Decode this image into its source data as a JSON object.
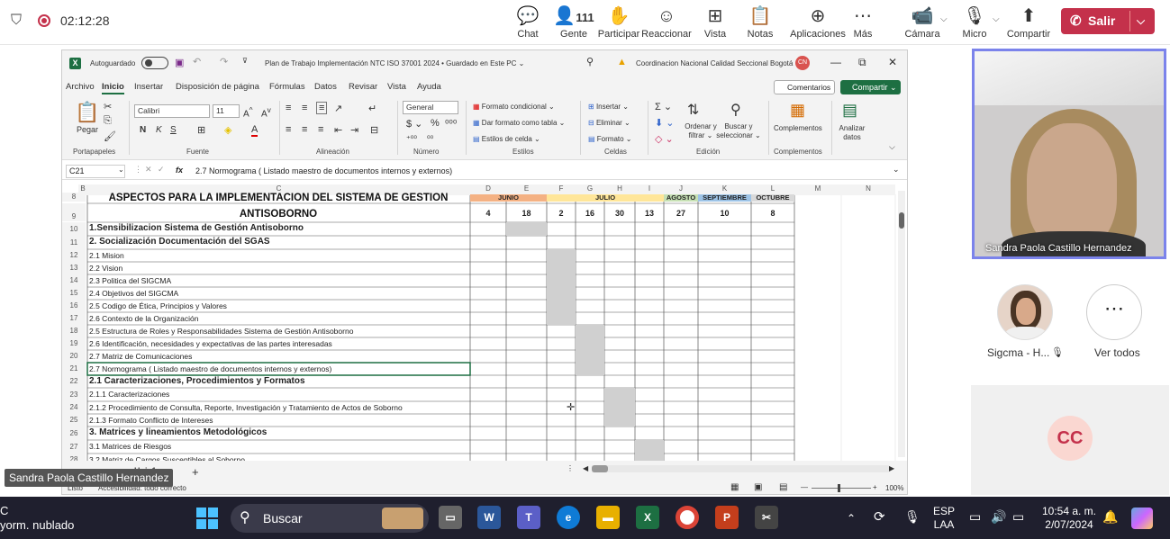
{
  "teams": {
    "timer": "02:12:28",
    "toolbar": [
      {
        "label": "Chat",
        "icon": "chat-icon",
        "glyph": "💬"
      },
      {
        "label": "Gente",
        "icon": "people-icon",
        "glyph": "👤",
        "count": "111"
      },
      {
        "label": "Participar",
        "icon": "hand-icon",
        "glyph": "✋"
      },
      {
        "label": "Reaccionar",
        "icon": "smile-icon",
        "glyph": "☺"
      },
      {
        "label": "Vista",
        "icon": "grid-icon",
        "glyph": "⊞"
      },
      {
        "label": "Notas",
        "icon": "notes-icon",
        "glyph": "📋"
      },
      {
        "label": "Aplicaciones",
        "icon": "apps-icon",
        "glyph": "⊕"
      },
      {
        "label": "Más",
        "icon": "more-icon",
        "glyph": "⋯"
      },
      {
        "label": "Cámara",
        "icon": "camera-off-icon",
        "glyph": "📹"
      },
      {
        "label": "Micro",
        "icon": "mic-off-icon",
        "glyph": "🎙"
      },
      {
        "label": "Compartir",
        "icon": "share-icon",
        "glyph": "⬆"
      }
    ],
    "leave": "Salir",
    "accent": "#c4314b"
  },
  "excel": {
    "autosave": "Autoguardado",
    "doc_title": "Plan de Trabajo Implementación NTC ISO 37001 2024  •  Guardado en Este PC ⌄",
    "user": "Coordinacion Nacional Calidad Seccional Bogotá",
    "user_initials": "CN",
    "menu": [
      "Archivo",
      "Inicio",
      "Insertar",
      "Disposición de página",
      "Fórmulas",
      "Datos",
      "Revisar",
      "Vista",
      "Ayuda"
    ],
    "comments": "Comentarios",
    "share": "Compartir",
    "ribbon": {
      "paste": "Pegar",
      "font": "Calibri",
      "size": "11",
      "number_format": "General",
      "cond_format": "Formato condicional ⌄",
      "table_format": "Dar formato como tabla ⌄",
      "cell_styles": "Estilos de celda ⌄",
      "insert": "Insertar ⌄",
      "delete": "Eliminar ⌄",
      "format": "Formato ⌄",
      "sort": "Ordenar y filtrar ⌄",
      "find": "Buscar y seleccionar ⌄",
      "addins": "Complementos",
      "analyze": "Analizar datos",
      "groups": [
        "Portapapeles",
        "Fuente",
        "Alineación",
        "Número",
        "Estilos",
        "Celdas",
        "Edición",
        "Complementos"
      ]
    },
    "namebox": "C21",
    "formula": "2.7 Normograma ( Listado maestro de documentos internos y externos)",
    "columns": [
      "B",
      "C",
      "D",
      "E",
      "F",
      "G",
      "H",
      "I",
      "J",
      "K",
      "L",
      "M",
      "N"
    ],
    "header_line1": "ASPECTOS PARA LA IMPLEMENTACION DEL SISTEMA DE GESTION",
    "header_line2": "ANTISOBORNO",
    "months": [
      {
        "name": "JUNIO",
        "color": "#f4b183"
      },
      {
        "name": "JULIO",
        "color": "#ffe699"
      },
      {
        "name": "AGOSTO",
        "color": "#c6e0b4"
      },
      {
        "name": "SEPTIEMBRE",
        "color": "#9dc3e6"
      },
      {
        "name": "OCTUBRE",
        "color": "#d9d9d9"
      }
    ],
    "days": [
      "4",
      "18",
      "2",
      "16",
      "30",
      "13",
      "27",
      "10",
      "8"
    ],
    "rows": [
      {
        "n": "8",
        "text": "",
        "bold": false
      },
      {
        "n": "9",
        "text": "",
        "bold": false
      },
      {
        "n": "10",
        "text": "1.Sensibilizacion Sistema de Gestión Antisoborno",
        "bold": true
      },
      {
        "n": "11",
        "text": "2. Socialización Documentación del SGAS",
        "bold": true
      },
      {
        "n": "12",
        "text": "2.1 Mision",
        "bold": false
      },
      {
        "n": "13",
        "text": "2.2 Vision",
        "bold": false
      },
      {
        "n": "14",
        "text": "2.3 Politica del SIGCMA",
        "bold": false
      },
      {
        "n": "15",
        "text": "2.4 Objetivos del SIGCMA",
        "bold": false
      },
      {
        "n": "16",
        "text": "2.5 Codigo de Ética, Principios y Valores",
        "bold": false
      },
      {
        "n": "17",
        "text": "2.6 Contexto de la Organización",
        "bold": false
      },
      {
        "n": "18",
        "text": "2.5 Estructura de Roles y Responsabilidades Sistema de Gestión Antisoborno",
        "bold": false
      },
      {
        "n": "19",
        "text": "2.6 Identificación, necesidades y expectativas de las partes interesadas",
        "bold": false
      },
      {
        "n": "20",
        "text": "2.7 Matriz de Comunicaciones",
        "bold": false
      },
      {
        "n": "21",
        "text": "2.7 Normograma ( Listado maestro de documentos internos y externos)",
        "bold": false
      },
      {
        "n": "22",
        "text": "2.1 Caracterizaciones, Procedimientos y Formatos",
        "bold": true
      },
      {
        "n": "23",
        "text": "2.1.1 Caracterizaciones",
        "bold": false
      },
      {
        "n": "24",
        "text": "2.1.2 Procedimiento de Consulta, Reporte, Investigación y Tratamiento de Actos de Soborno",
        "bold": false
      },
      {
        "n": "25",
        "text": "2.1.3 Formato Conflicto de Intereses",
        "bold": false
      },
      {
        "n": "26",
        "text": "3. Matrices y lineamientos Metodológicos",
        "bold": true
      },
      {
        "n": "27",
        "text": "3.1  Matrices de Riesgos",
        "bold": false
      },
      {
        "n": "28",
        "text": "3.2 Matriz de Cargos Susceptibles al Soborno",
        "bold": false
      }
    ],
    "sheet": "Hoja1",
    "status_ready": "Listo",
    "accessibility": "Accesibilidad: todo correcto",
    "zoom": "100%"
  },
  "participants": {
    "main": "Sandra Paola Castillo Hernandez",
    "second": "Sigcma - H...",
    "view_all": "Ver todos",
    "cc": "CC",
    "tooltip": "Sandra Paola Castillo Hernandez"
  },
  "taskbar": {
    "weather_temp": "C",
    "weather_desc": "yorm. nublado",
    "search": "Buscar",
    "lang1": "ESP",
    "lang2": "LAA",
    "time": "10:54 a. m.",
    "date": "2/07/2024"
  }
}
